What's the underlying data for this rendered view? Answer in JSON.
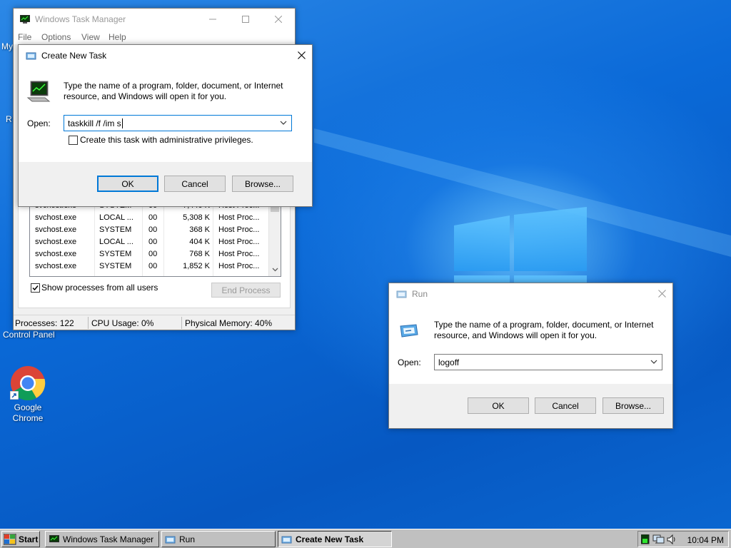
{
  "desktop": {
    "icons": [
      {
        "label_lines": [
          "Google",
          "Chrome"
        ]
      }
    ],
    "partial_labels": {
      "my_computer": "My",
      "recycle": "R",
      "control_panel": "Control Panel"
    }
  },
  "task_manager": {
    "title": "Windows Task Manager",
    "menu": [
      "File",
      "Options",
      "View",
      "Help"
    ],
    "processes": [
      {
        "name": "svchost.exe",
        "user": "SYSTEM",
        "cpu": "00",
        "mem": "7,440 K",
        "desc": "Host Proc..."
      },
      {
        "name": "svchost.exe",
        "user": "LOCAL ...",
        "cpu": "00",
        "mem": "5,308 K",
        "desc": "Host Proc..."
      },
      {
        "name": "svchost.exe",
        "user": "SYSTEM",
        "cpu": "00",
        "mem": "368 K",
        "desc": "Host Proc..."
      },
      {
        "name": "svchost.exe",
        "user": "LOCAL ...",
        "cpu": "00",
        "mem": "404 K",
        "desc": "Host Proc..."
      },
      {
        "name": "svchost.exe",
        "user": "SYSTEM",
        "cpu": "00",
        "mem": "768 K",
        "desc": "Host Proc..."
      },
      {
        "name": "svchost.exe",
        "user": "SYSTEM",
        "cpu": "00",
        "mem": "1,852 K",
        "desc": "Host Proc..."
      }
    ],
    "show_all_label": "Show processes from all users",
    "show_all_checked": true,
    "end_process_label": "End Process",
    "status": {
      "processes": "Processes: 122",
      "cpu": "CPU Usage: 0%",
      "memory": "Physical Memory: 40%"
    }
  },
  "create_task": {
    "title": "Create New Task",
    "description": "Type the name of a program, folder, document, or Internet resource, and Windows will open it for you.",
    "open_label": "Open:",
    "input_value": "taskkill /f /im s",
    "admin_label": "Create this task with administrative privileges.",
    "admin_checked": false,
    "ok_label": "OK",
    "cancel_label": "Cancel",
    "browse_label": "Browse..."
  },
  "run_dialog": {
    "title": "Run",
    "description": "Type the name of a program, folder, document, or Internet resource, and Windows will open it for you.",
    "open_label": "Open:",
    "input_value": "logoff",
    "ok_label": "OK",
    "cancel_label": "Cancel",
    "browse_label": "Browse..."
  },
  "taskbar": {
    "start_label": "Start",
    "items": [
      {
        "label": "Windows Task Manager",
        "active": false
      },
      {
        "label": "Run",
        "active": false
      },
      {
        "label": "Create New Task",
        "active": true
      }
    ],
    "clock": "10:04 PM"
  },
  "colors": {
    "accent": "#0078d7",
    "desktop_blue": "#0a67d4"
  }
}
